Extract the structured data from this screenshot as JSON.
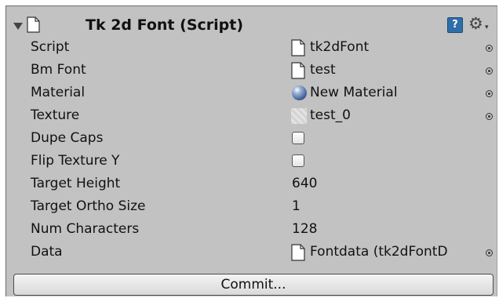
{
  "component": {
    "title": "Tk 2d Font (Script)",
    "help_glyph": "?",
    "gear_glyph": "⚙",
    "gear_caret": "▾"
  },
  "fields": {
    "script": {
      "label": "Script",
      "value": "tk2dFont",
      "icon": "script-file-icon"
    },
    "bm_font": {
      "label": "Bm Font",
      "value": "test",
      "icon": "text-file-icon"
    },
    "material": {
      "label": "Material",
      "value": "New Material",
      "icon": "material-sphere-icon"
    },
    "texture": {
      "label": "Texture",
      "value": "test_0",
      "icon": "texture-thumbnail-icon"
    },
    "dupe_caps": {
      "label": "Dupe Caps",
      "checked": false
    },
    "flip_texture_y": {
      "label": "Flip Texture Y",
      "checked": false
    },
    "target_height": {
      "label": "Target Height",
      "value": "640"
    },
    "target_ortho_size": {
      "label": "Target Ortho Size",
      "value": "1"
    },
    "num_characters": {
      "label": "Num Characters",
      "value": "128"
    },
    "data": {
      "label": "Data",
      "value": "Fontdata (tk2dFontD",
      "icon": "data-file-icon"
    }
  },
  "commit_button": {
    "label": "Commit..."
  },
  "colors": {
    "panel_bg": "#c2c2c2",
    "help_blue": "#2f6ea8",
    "material_blue": "#3e5f96"
  }
}
